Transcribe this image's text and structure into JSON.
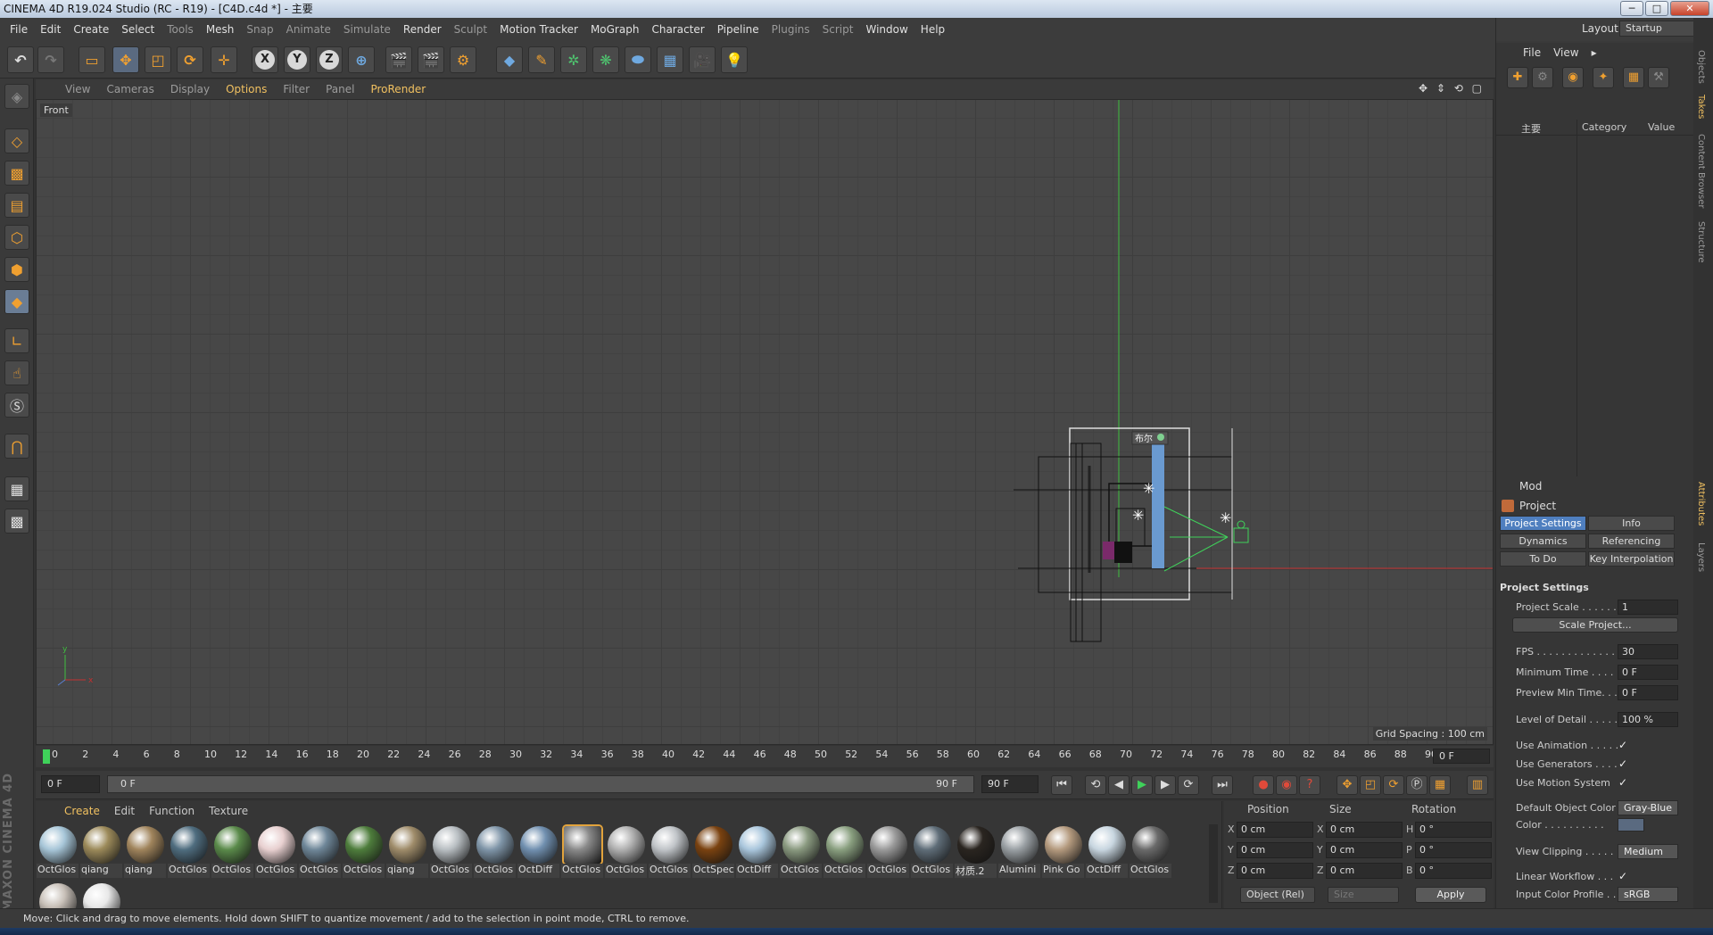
{
  "window": {
    "title": "CINEMA 4D R19.024 Studio (RC - R19) - [C4D.c4d *] - 主要",
    "min": "─",
    "max": "□",
    "close": "✕"
  },
  "menubar": [
    "File",
    "Edit",
    "Create",
    "Select",
    "Tools",
    "Mesh",
    "Snap",
    "Animate",
    "Simulate",
    "Render",
    "Sculpt",
    "Motion Tracker",
    "MoGraph",
    "Character",
    "Pipeline",
    "Plugins",
    "Script",
    "Window",
    "Help"
  ],
  "layout": {
    "label": "Layout:",
    "value": "Startup"
  },
  "viewport_menu": [
    "View",
    "Cameras",
    "Display",
    "Options",
    "Filter",
    "Panel",
    "ProRender"
  ],
  "viewport": {
    "name": "Front",
    "grid_spacing": "Grid Spacing : 100 cm",
    "scene_label": "布尔"
  },
  "timeline": {
    "ticks": [
      "0",
      "2",
      "4",
      "6",
      "8",
      "10",
      "12",
      "14",
      "16",
      "18",
      "20",
      "22",
      "24",
      "26",
      "28",
      "30",
      "32",
      "34",
      "36",
      "38",
      "40",
      "42",
      "44",
      "46",
      "48",
      "50",
      "52",
      "54",
      "56",
      "58",
      "60",
      "62",
      "64",
      "66",
      "68",
      "70",
      "72",
      "74",
      "76",
      "78",
      "80",
      "82",
      "84",
      "86",
      "88",
      "90"
    ],
    "current": "0 F",
    "start": "0 F",
    "bar_left": "0 F",
    "bar_right": "90 F",
    "end": "90 F"
  },
  "material_menu": [
    "Create",
    "Edit",
    "Function",
    "Texture"
  ],
  "materials": [
    {
      "name": "OctGlos",
      "color": "#a7c6d8"
    },
    {
      "name": "qiang",
      "color": "#9c8a5a"
    },
    {
      "name": "qiang",
      "color": "#a0845c"
    },
    {
      "name": "OctGlos",
      "color": "#4f6d7f"
    },
    {
      "name": "OctGlos",
      "color": "#5a8a4a"
    },
    {
      "name": "OctGlos",
      "color": "#e8d0d0"
    },
    {
      "name": "OctGlos",
      "color": "#6f8799"
    },
    {
      "name": "OctGlos",
      "color": "#4e7d3c"
    },
    {
      "name": "qiang",
      "color": "#9f8c6a"
    },
    {
      "name": "OctGlos",
      "color": "#b8bec2"
    },
    {
      "name": "OctGlos",
      "color": "#7f95a8"
    },
    {
      "name": "OctDiff",
      "color": "#7190b0"
    },
    {
      "name": "OctGlos",
      "color": "#8a8a8a"
    },
    {
      "name": "OctGlos",
      "color": "#b0b0b0"
    },
    {
      "name": "OctGlos",
      "color": "#c0c4c8"
    },
    {
      "name": "OctSpec",
      "color": "#7a4210"
    },
    {
      "name": "OctDiff",
      "color": "#a9c6dc"
    },
    {
      "name": "OctGlos",
      "color": "#8a9a80"
    },
    {
      "name": "OctGlos",
      "color": "#8aa080"
    },
    {
      "name": "OctGlos",
      "color": "#9a9a9a"
    },
    {
      "name": "OctGlos",
      "color": "#5f6d78"
    },
    {
      "name": "材质.2",
      "color": "#2a2520"
    },
    {
      "name": "Alumini",
      "color": "#9aa0a4"
    },
    {
      "name": "Pink Go",
      "color": "#b49a7e"
    },
    {
      "name": "OctDiff",
      "color": "#c8d6e0"
    },
    {
      "name": "OctGlos",
      "color": "#6a6a6a"
    },
    {
      "name": "",
      "color": "#c8c0b8"
    },
    {
      "name": "",
      "color": "#e8e8e8"
    }
  ],
  "coordinates": {
    "headers": [
      "Position",
      "Size",
      "Rotation"
    ],
    "rows": [
      {
        "a": "X",
        "pos": "0 cm",
        "b": "X",
        "size": "0 cm",
        "c": "H",
        "rot": "0 °"
      },
      {
        "a": "Y",
        "pos": "0 cm",
        "b": "Y",
        "size": "0 cm",
        "c": "P",
        "rot": "0 °"
      },
      {
        "a": "Z",
        "pos": "0 cm",
        "b": "Z",
        "size": "0 cm",
        "c": "B",
        "rot": "0 °"
      }
    ],
    "mode": "Object (Rel)",
    "size_mode": "Size",
    "apply": "Apply"
  },
  "status": "Move: Click and drag to move elements. Hold down SHIFT to quantize movement / add to the selection in point mode, CTRL to remove.",
  "object_manager": {
    "menu": [
      "File",
      "View"
    ],
    "columns": {
      "name": "主要",
      "category": "Category",
      "value": "Value"
    }
  },
  "attributes": {
    "menu": "Mod",
    "object": "Project",
    "tabs_row1": [
      "Project Settings",
      "Info"
    ],
    "tabs_row2": [
      "Dynamics",
      "Referencing"
    ],
    "tabs_row3": [
      "To Do",
      "Key Interpolation"
    ],
    "section": "Project Settings",
    "project_scale_label": "Project Scale . . . . . .",
    "project_scale": "1",
    "scale_button": "Scale Project...",
    "fps_label": "FPS . . . . . . . . . . . . . .",
    "fps": "30",
    "min_time_label": "Minimum Time . . . . .",
    "min_time": "0 F",
    "preview_min_label": "Preview Min Time. . .",
    "preview_min": "0 F",
    "lod_label": "Level of Detail . . . . .",
    "lod": "100 %",
    "use_anim_label": "Use Animation . . . . .",
    "use_gen_label": "Use Generators . . . .",
    "use_motion_label": "Use Motion System",
    "def_color_label": "Default Object Color",
    "def_color": "Gray-Blue",
    "color_label": "Color . . . . . . . . . .",
    "clip_label": "View Clipping . . . . . .",
    "clip": "Medium",
    "linear_label": "Linear Workflow . . .",
    "profile_label": "Input Color Profile . .",
    "profile": "sRGB",
    "checkmark": "✓"
  },
  "side_tabs": [
    "Objects",
    "Takes",
    "Content Browser",
    "Structure",
    "Attributes",
    "Layers"
  ]
}
